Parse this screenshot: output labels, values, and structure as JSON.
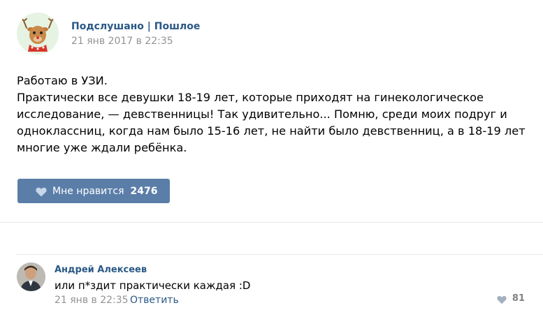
{
  "post": {
    "author": "Подслушано | Пошлое",
    "date": "21 янв 2017 в 22:35",
    "avatar_icon": "deer-avatar-icon",
    "text_lines": [
      "Работаю в УЗИ.",
      "Практически все девушки 18-19 лет, которые приходят на гинекологическое",
      "исследование, — девственницы! Так удивительно... Помню, среди моих подруг и",
      "одноклассниц, когда нам было 15-16 лет, не найти было девственниц, а в 18-19 лет",
      "многие уже ждали ребёнка."
    ],
    "like": {
      "icon": "heart-icon",
      "label": "Мне нравится",
      "count": "2476"
    }
  },
  "comment": {
    "author": "Андрей Алексеев",
    "text": "или п*здит практически каждая :D",
    "date": "21 янв в 22:35",
    "reply_label": "Ответить",
    "like_icon": "heart-icon",
    "like_count": "81"
  },
  "colors": {
    "link": "#2a5885",
    "like_button": "#5b7ea9",
    "muted": "#939393",
    "divider": "#e4e6ea"
  }
}
